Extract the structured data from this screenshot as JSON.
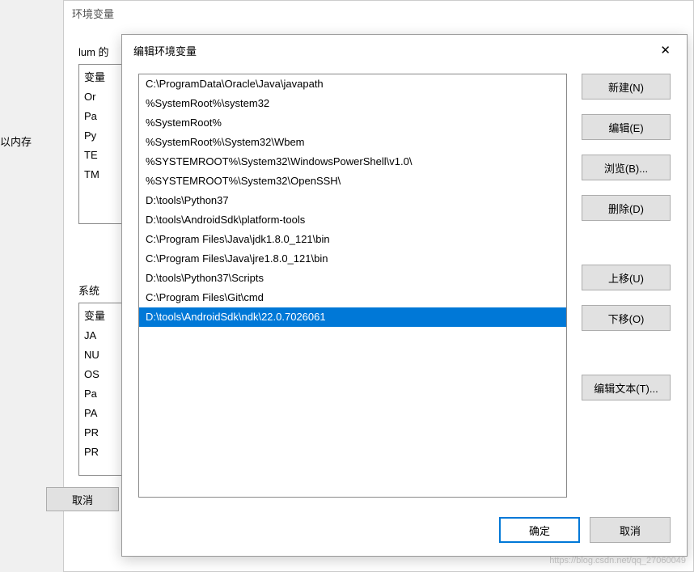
{
  "leftText": "以内存",
  "parentDialog": {
    "title": "环境变量",
    "section1Label": "lum 的",
    "section2Label": "系统",
    "userVars": [
      "变量",
      "Or",
      "Pa",
      "Py",
      "TE",
      "TM"
    ],
    "sysVars": [
      "变量",
      "JA",
      "NU",
      "OS",
      "Pa",
      "PA",
      "PR",
      "PR"
    ],
    "cancelBtn": "取消"
  },
  "mainDialog": {
    "title": "编辑环境变量",
    "paths": [
      "C:\\ProgramData\\Oracle\\Java\\javapath",
      "%SystemRoot%\\system32",
      "%SystemRoot%",
      "%SystemRoot%\\System32\\Wbem",
      "%SYSTEMROOT%\\System32\\WindowsPowerShell\\v1.0\\",
      "%SYSTEMROOT%\\System32\\OpenSSH\\",
      "D:\\tools\\Python37",
      "D:\\tools\\AndroidSdk\\platform-tools",
      "C:\\Program Files\\Java\\jdk1.8.0_121\\bin",
      "C:\\Program Files\\Java\\jre1.8.0_121\\bin",
      "D:\\tools\\Python37\\Scripts",
      "C:\\Program Files\\Git\\cmd",
      "D:\\tools\\AndroidSdk\\ndk\\22.0.7026061"
    ],
    "selectedIndex": 12,
    "buttons": {
      "new": "新建(N)",
      "edit": "编辑(E)",
      "browse": "浏览(B)...",
      "delete": "删除(D)",
      "moveUp": "上移(U)",
      "moveDown": "下移(O)",
      "editText": "编辑文本(T)..."
    },
    "ok": "确定",
    "cancel": "取消"
  },
  "watermark": "https://blog.csdn.net/qq_27060049"
}
